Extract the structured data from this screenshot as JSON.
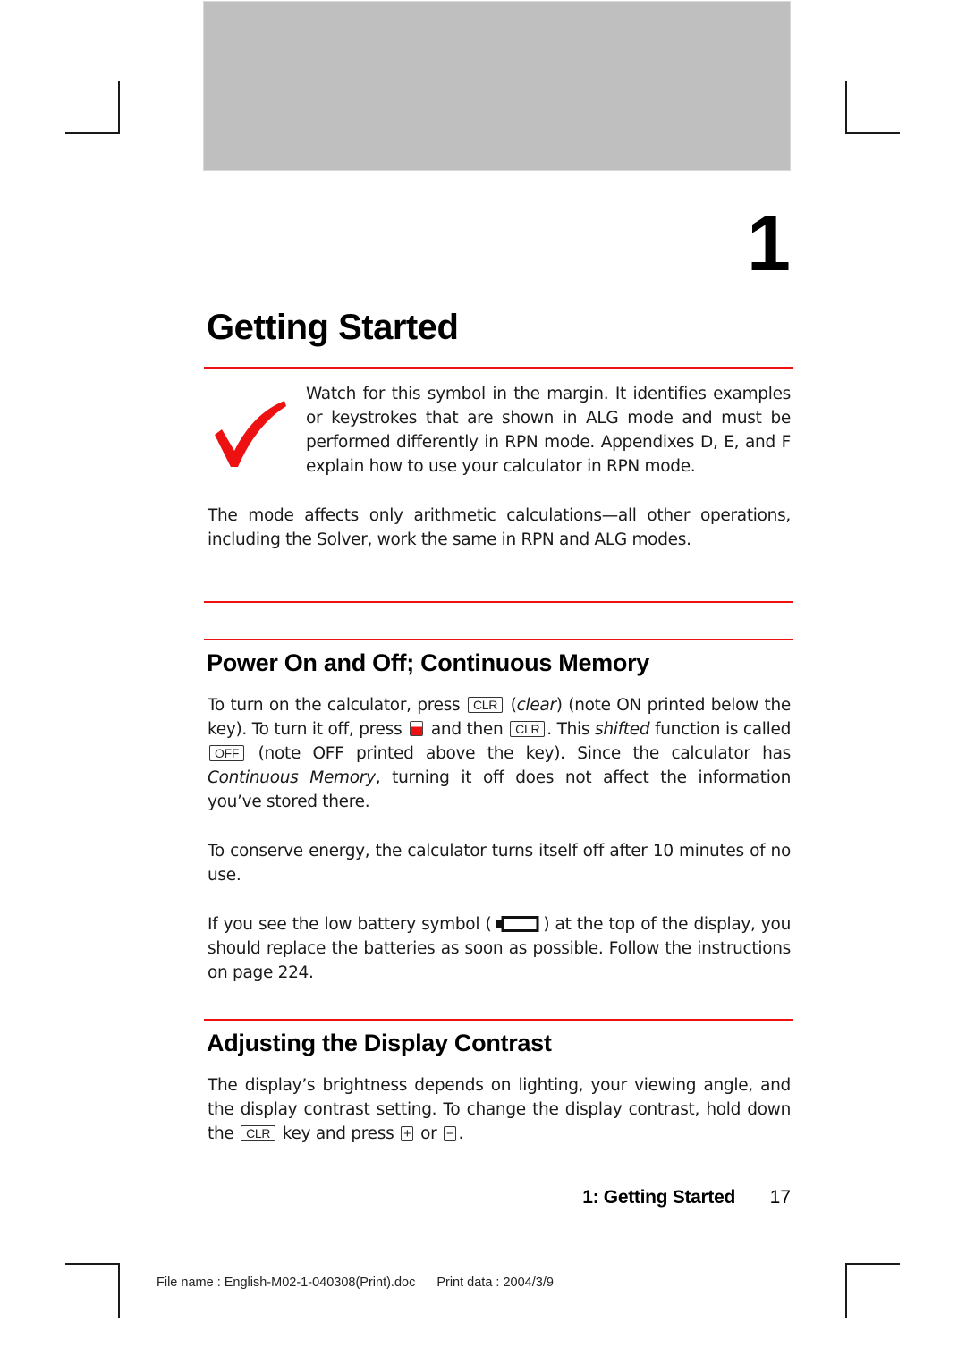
{
  "chapter": {
    "number": "1",
    "title": "Getting Started"
  },
  "margin_note": {
    "icon": "red-checkmark-icon",
    "text": "Watch for this symbol in the margin. It identifies examples or keystrokes that are shown in ALG mode and must be performed differently in RPN mode. Appendixes D, E, and F explain how to use your calculator in RPN mode."
  },
  "intro_paragraph": "The mode affects only arithmetic calculations—all other operations, including the Solver, work the same in RPN and ALG modes.",
  "sections": {
    "power": {
      "heading": "Power On and Off; Continuous Memory",
      "p1": {
        "a": "To turn on the calculator, press",
        "key_clr": "CLR",
        "b_italic": "clear",
        "c": "(note ON printed below the key). To turn it off, press",
        "d": "and then",
        "e": ". This",
        "f_italic": "shifted",
        "g": "function is called",
        "key_off": "OFF",
        "h": "(note OFF printed above the key). Since the calculator has",
        "i_italic": "Continuous Memory",
        "j": ", turning it off does not affect the information you’ve stored there."
      },
      "p2": "To conserve energy, the calculator turns itself off after 10 minutes of no use.",
      "p3": {
        "a": "If you see the low battery symbol (",
        "battery_icon": "low-battery-icon",
        "b": ") at the top of the display, you should replace the batteries as soon as possible. Follow the instructions on page 224."
      }
    },
    "contrast": {
      "heading": "Adjusting the Display Contrast",
      "p1": {
        "a": "The display’s brightness depends on lighting, your viewing angle, and the display contrast setting. To change the display contrast, hold down the",
        "key_clr": "CLR",
        "b": "key and press",
        "key_plus": "+",
        "c": "or",
        "key_minus": "−",
        "d": "."
      }
    }
  },
  "footer": {
    "running_title": "1: Getting Started",
    "page_number": "17",
    "file_name": "File name : English-M02-1-040308(Print).doc",
    "print_date": "Print data : 2004/3/9"
  },
  "colors": {
    "accent_red": "#ee1111",
    "header_gray": "#bfbfbf"
  }
}
